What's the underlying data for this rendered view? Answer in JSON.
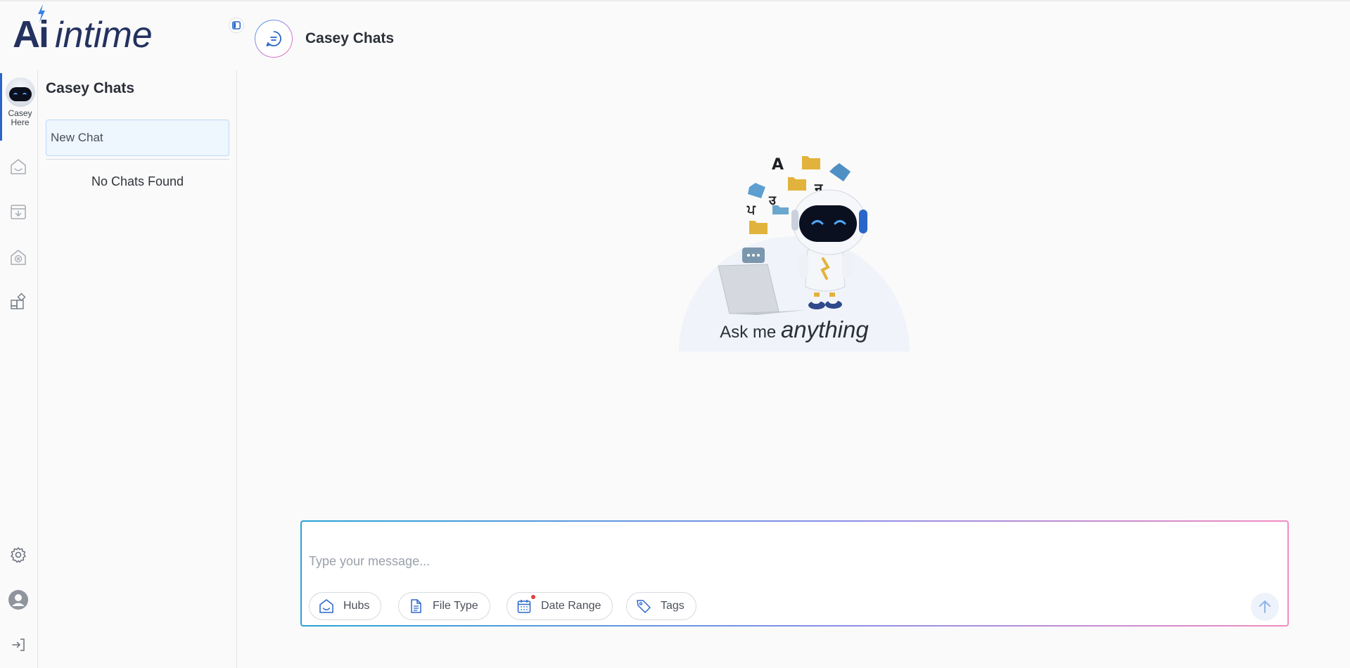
{
  "brand": {
    "logo_ai": "Ai",
    "logo_rest": "intime"
  },
  "rail": {
    "active_label_line1": "Casey",
    "active_label_line2": "Here",
    "icons": [
      "hub-icon",
      "archive-icon",
      "cancel-hub-icon",
      "apps-icon",
      "settings-icon",
      "profile-icon",
      "logout-icon"
    ]
  },
  "panel": {
    "title": "Casey Chats",
    "new_chat_label": "New Chat",
    "empty_label": "No Chats Found"
  },
  "header": {
    "title": "Casey Chats"
  },
  "hero": {
    "tagline_lead": "Ask me",
    "tagline_emphasis": "anything",
    "glyphs": [
      "A",
      "न",
      "उ",
      "ਪ"
    ]
  },
  "composer": {
    "placeholder": "Type your message...",
    "filters": [
      {
        "label": "Hubs",
        "icon": "hub-icon"
      },
      {
        "label": "File Type",
        "icon": "document-icon"
      },
      {
        "label": "Date Range",
        "icon": "calendar-icon"
      },
      {
        "label": "Tags",
        "icon": "tag-icon"
      }
    ]
  },
  "colors": {
    "brand_navy": "#23325f",
    "accent_blue": "#2a66c9",
    "gradient_start": "#2aa3d4",
    "gradient_end": "#f28cc0",
    "new_chat_bg": "#eef6fe",
    "notification_dot": "#e0413c"
  }
}
